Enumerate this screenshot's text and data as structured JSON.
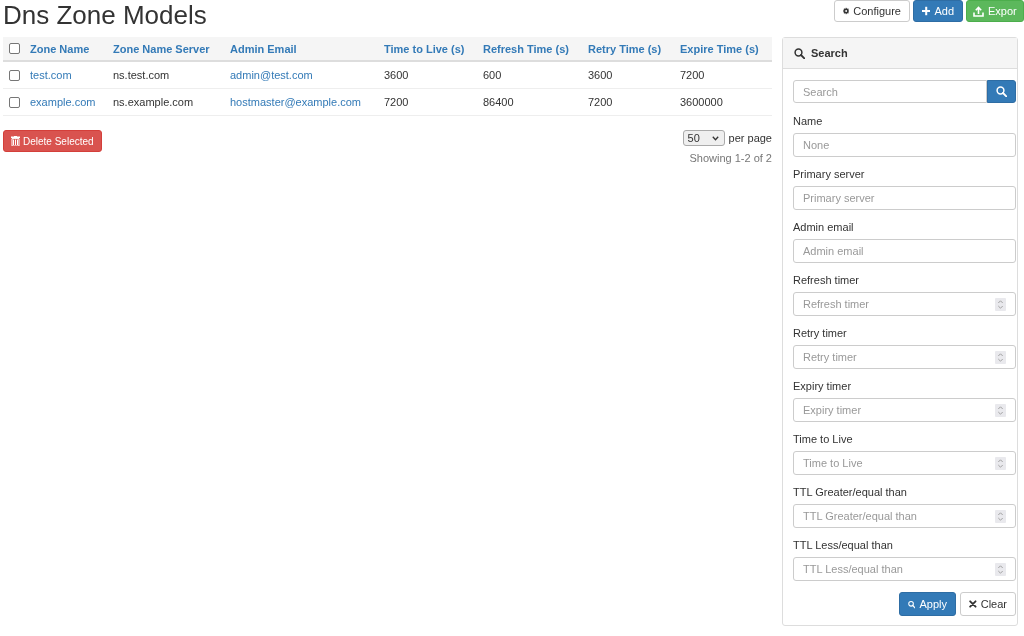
{
  "page": {
    "title": "Dns Zone Models"
  },
  "toolbar": [
    {
      "label": "Configure",
      "kind": "default"
    },
    {
      "label": "Add",
      "kind": "primary"
    },
    {
      "label": "Expor",
      "kind": "success"
    }
  ],
  "table": {
    "select_all": {
      "checked": false
    },
    "columns": [
      {
        "label": "Zone Name",
        "kind": "link"
      },
      {
        "label": "Zone Name Server",
        "kind": "text"
      },
      {
        "label": "Admin Email",
        "kind": "link"
      },
      {
        "label": "Time to Live (s)",
        "kind": "text"
      },
      {
        "label": "Refresh Time (s)",
        "kind": "text"
      },
      {
        "label": "Retry Time (s)",
        "kind": "text"
      },
      {
        "label": "Expire Time (s)",
        "kind": "text"
      }
    ],
    "rows": [
      {
        "checked": false,
        "cells": [
          "test.com",
          "ns.test.com",
          "admin@test.com",
          "3600",
          "600",
          "3600",
          "7200"
        ]
      },
      {
        "checked": false,
        "cells": [
          "example.com",
          "ns.example.com",
          "hostmaster@example.com",
          "7200",
          "86400",
          "7200",
          "3600000"
        ]
      }
    ]
  },
  "bulk_action": {
    "label": "Delete Selected",
    "kind": "danger"
  },
  "pagination": {
    "per_page": "50",
    "per_page_label": "per page",
    "summary": "Showing 1-2 of 2"
  },
  "search_panel": {
    "title": "Search",
    "search": {
      "placeholder": "Search"
    },
    "fields": [
      {
        "label": "Name",
        "placeholder": "None",
        "kind": "text"
      },
      {
        "label": "Primary server",
        "placeholder": "Primary server",
        "kind": "text"
      },
      {
        "label": "Admin email",
        "placeholder": "Admin email",
        "kind": "text"
      },
      {
        "label": "Refresh timer",
        "placeholder": "Refresh timer",
        "kind": "number"
      },
      {
        "label": "Retry timer",
        "placeholder": "Retry timer",
        "kind": "number"
      },
      {
        "label": "Expiry timer",
        "placeholder": "Expiry timer",
        "kind": "number"
      },
      {
        "label": "Time to Live",
        "placeholder": "Time to Live",
        "kind": "number"
      },
      {
        "label": "TTL Greater/equal than",
        "placeholder": "TTL Greater/equal than",
        "kind": "number"
      },
      {
        "label": "TTL Less/equal than",
        "placeholder": "TTL Less/equal than",
        "kind": "number"
      }
    ],
    "buttons": [
      {
        "label": "Apply",
        "kind": "primary"
      },
      {
        "label": "Clear",
        "kind": "default"
      }
    ]
  }
}
